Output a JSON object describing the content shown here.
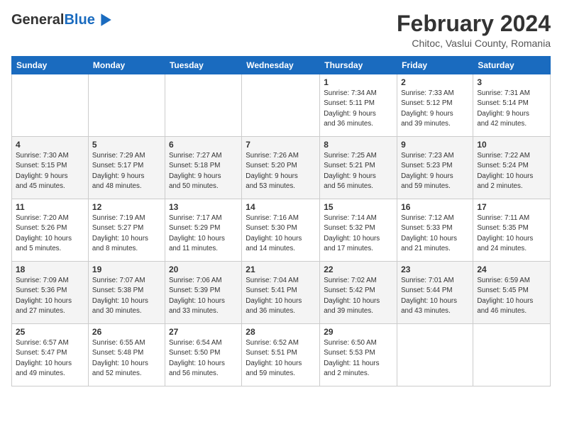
{
  "header": {
    "logo_general": "General",
    "logo_blue": "Blue",
    "title": "February 2024",
    "subtitle": "Chitoc, Vaslui County, Romania"
  },
  "days_of_week": [
    "Sunday",
    "Monday",
    "Tuesday",
    "Wednesday",
    "Thursday",
    "Friday",
    "Saturday"
  ],
  "weeks": [
    [
      {
        "day": "",
        "info": ""
      },
      {
        "day": "",
        "info": ""
      },
      {
        "day": "",
        "info": ""
      },
      {
        "day": "",
        "info": ""
      },
      {
        "day": "1",
        "info": "Sunrise: 7:34 AM\nSunset: 5:11 PM\nDaylight: 9 hours\nand 36 minutes."
      },
      {
        "day": "2",
        "info": "Sunrise: 7:33 AM\nSunset: 5:12 PM\nDaylight: 9 hours\nand 39 minutes."
      },
      {
        "day": "3",
        "info": "Sunrise: 7:31 AM\nSunset: 5:14 PM\nDaylight: 9 hours\nand 42 minutes."
      }
    ],
    [
      {
        "day": "4",
        "info": "Sunrise: 7:30 AM\nSunset: 5:15 PM\nDaylight: 9 hours\nand 45 minutes."
      },
      {
        "day": "5",
        "info": "Sunrise: 7:29 AM\nSunset: 5:17 PM\nDaylight: 9 hours\nand 48 minutes."
      },
      {
        "day": "6",
        "info": "Sunrise: 7:27 AM\nSunset: 5:18 PM\nDaylight: 9 hours\nand 50 minutes."
      },
      {
        "day": "7",
        "info": "Sunrise: 7:26 AM\nSunset: 5:20 PM\nDaylight: 9 hours\nand 53 minutes."
      },
      {
        "day": "8",
        "info": "Sunrise: 7:25 AM\nSunset: 5:21 PM\nDaylight: 9 hours\nand 56 minutes."
      },
      {
        "day": "9",
        "info": "Sunrise: 7:23 AM\nSunset: 5:23 PM\nDaylight: 9 hours\nand 59 minutes."
      },
      {
        "day": "10",
        "info": "Sunrise: 7:22 AM\nSunset: 5:24 PM\nDaylight: 10 hours\nand 2 minutes."
      }
    ],
    [
      {
        "day": "11",
        "info": "Sunrise: 7:20 AM\nSunset: 5:26 PM\nDaylight: 10 hours\nand 5 minutes."
      },
      {
        "day": "12",
        "info": "Sunrise: 7:19 AM\nSunset: 5:27 PM\nDaylight: 10 hours\nand 8 minutes."
      },
      {
        "day": "13",
        "info": "Sunrise: 7:17 AM\nSunset: 5:29 PM\nDaylight: 10 hours\nand 11 minutes."
      },
      {
        "day": "14",
        "info": "Sunrise: 7:16 AM\nSunset: 5:30 PM\nDaylight: 10 hours\nand 14 minutes."
      },
      {
        "day": "15",
        "info": "Sunrise: 7:14 AM\nSunset: 5:32 PM\nDaylight: 10 hours\nand 17 minutes."
      },
      {
        "day": "16",
        "info": "Sunrise: 7:12 AM\nSunset: 5:33 PM\nDaylight: 10 hours\nand 21 minutes."
      },
      {
        "day": "17",
        "info": "Sunrise: 7:11 AM\nSunset: 5:35 PM\nDaylight: 10 hours\nand 24 minutes."
      }
    ],
    [
      {
        "day": "18",
        "info": "Sunrise: 7:09 AM\nSunset: 5:36 PM\nDaylight: 10 hours\nand 27 minutes."
      },
      {
        "day": "19",
        "info": "Sunrise: 7:07 AM\nSunset: 5:38 PM\nDaylight: 10 hours\nand 30 minutes."
      },
      {
        "day": "20",
        "info": "Sunrise: 7:06 AM\nSunset: 5:39 PM\nDaylight: 10 hours\nand 33 minutes."
      },
      {
        "day": "21",
        "info": "Sunrise: 7:04 AM\nSunset: 5:41 PM\nDaylight: 10 hours\nand 36 minutes."
      },
      {
        "day": "22",
        "info": "Sunrise: 7:02 AM\nSunset: 5:42 PM\nDaylight: 10 hours\nand 39 minutes."
      },
      {
        "day": "23",
        "info": "Sunrise: 7:01 AM\nSunset: 5:44 PM\nDaylight: 10 hours\nand 43 minutes."
      },
      {
        "day": "24",
        "info": "Sunrise: 6:59 AM\nSunset: 5:45 PM\nDaylight: 10 hours\nand 46 minutes."
      }
    ],
    [
      {
        "day": "25",
        "info": "Sunrise: 6:57 AM\nSunset: 5:47 PM\nDaylight: 10 hours\nand 49 minutes."
      },
      {
        "day": "26",
        "info": "Sunrise: 6:55 AM\nSunset: 5:48 PM\nDaylight: 10 hours\nand 52 minutes."
      },
      {
        "day": "27",
        "info": "Sunrise: 6:54 AM\nSunset: 5:50 PM\nDaylight: 10 hours\nand 56 minutes."
      },
      {
        "day": "28",
        "info": "Sunrise: 6:52 AM\nSunset: 5:51 PM\nDaylight: 10 hours\nand 59 minutes."
      },
      {
        "day": "29",
        "info": "Sunrise: 6:50 AM\nSunset: 5:53 PM\nDaylight: 11 hours\nand 2 minutes."
      },
      {
        "day": "",
        "info": ""
      },
      {
        "day": "",
        "info": ""
      }
    ]
  ]
}
